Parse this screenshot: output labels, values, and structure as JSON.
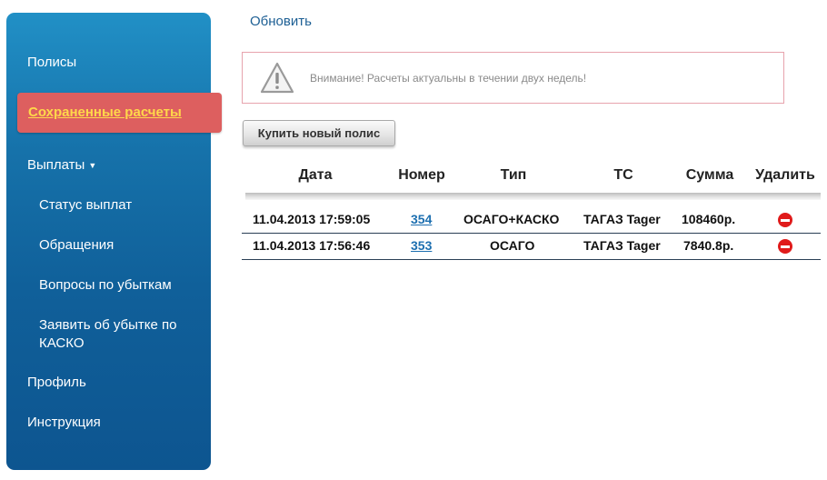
{
  "sidebar": {
    "items": [
      {
        "label": "Полисы"
      },
      {
        "label": "Сохраненные расчеты",
        "active": true
      },
      {
        "label": "Выплаты",
        "caret": "▼"
      },
      {
        "label": "Статус выплат"
      },
      {
        "label": "Обращения"
      },
      {
        "label": "Вопросы по убыткам"
      },
      {
        "label": "Заявить об убытке по КАСКО"
      },
      {
        "label": "Профиль"
      },
      {
        "label": "Инструкция"
      }
    ]
  },
  "main": {
    "refresh_label": "Обновить",
    "warning": {
      "icon": "warning-triangle-icon",
      "text": "Внимание! Расчеты актуальны в течении двух недель!"
    },
    "buy_button_label": "Купить новый полис",
    "table": {
      "headers": [
        "Дата",
        "Номер",
        "Тип",
        "ТС",
        "Сумма",
        "Удалить"
      ],
      "rows": [
        {
          "date": "11.04.2013 17:59:05",
          "number": "354",
          "type": "ОСАГО+КАСКО",
          "vehicle": "ТАГАЗ Tager",
          "sum": "108460р.",
          "delete_icon": "delete-icon"
        },
        {
          "date": "11.04.2013 17:56:46",
          "number": "353",
          "type": "ОСАГО",
          "vehicle": "ТАГАЗ Tager",
          "sum": "7840.8р.",
          "delete_icon": "delete-icon"
        }
      ]
    }
  },
  "colors": {
    "sidebar_top": "#2190c6",
    "sidebar_bottom": "#0d5590",
    "active_item_bg": "#dd5f5f",
    "active_item_text": "#ffd84a",
    "link": "#1d6fb0",
    "warning_border": "#e7a3ad",
    "delete": "#e01b1b"
  }
}
